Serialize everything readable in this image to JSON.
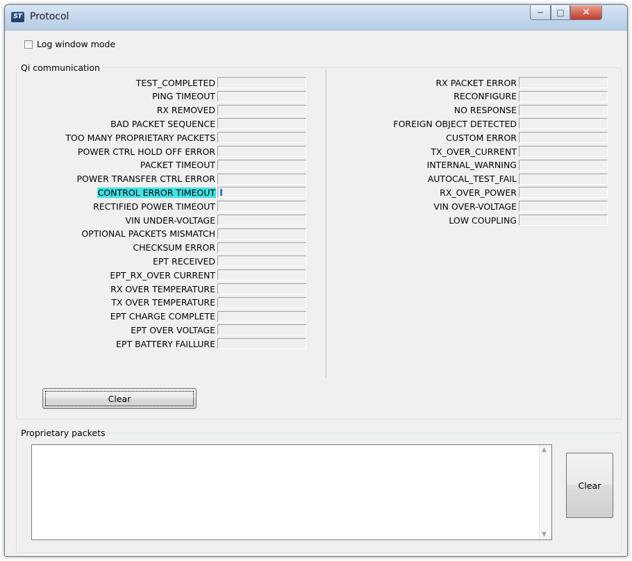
{
  "window": {
    "title": "Protocol",
    "app_icon": "st-logo-icon"
  },
  "log_mode": {
    "label": "Log window mode",
    "checked": false
  },
  "qi": {
    "legend": "Qi communication",
    "left": [
      "TEST_COMPLETED",
      "PING TIMEOUT",
      "RX REMOVED",
      "BAD PACKET SEQUENCE",
      "TOO MANY PROPRIETARY PACKETS",
      "POWER CTRL HOLD OFF ERROR",
      "PACKET TIMEOUT",
      "POWER TRANSFER CTRL ERROR",
      "CONTROL ERROR TIMEOUT",
      "RECTIFIED POWER TIMEOUT",
      "VIN UNDER-VOLTAGE",
      "OPTIONAL PACKETS MISMATCH",
      "CHECKSUM ERROR",
      "EPT RECEIVED",
      "EPT_RX_OVER CURRENT",
      "RX OVER TEMPERATURE",
      "TX OVER TEMPERATURE",
      "EPT CHARGE COMPLETE",
      "EPT OVER VOLTAGE",
      "EPT BATTERY FAILLURE"
    ],
    "right": [
      "RX PACKET ERROR",
      "RECONFIGURE",
      "NO RESPONSE",
      "FOREIGN OBJECT DETECTED",
      "CUSTOM ERROR",
      "TX_OVER_CURRENT",
      "INTERNAL_WARNING",
      "AUTOCAL_TEST_FAIL",
      "RX_OVER_POWER",
      "VIN OVER-VOLTAGE",
      "LOW COUPLING"
    ],
    "highlighted": "CONTROL ERROR TIMEOUT",
    "highlight_color": "#3fe2e5",
    "indicator_color": "#2f7ad8",
    "clear_label": "Clear"
  },
  "proprietary": {
    "legend": "Proprietary packets",
    "text": "",
    "clear_label": "Clear"
  }
}
